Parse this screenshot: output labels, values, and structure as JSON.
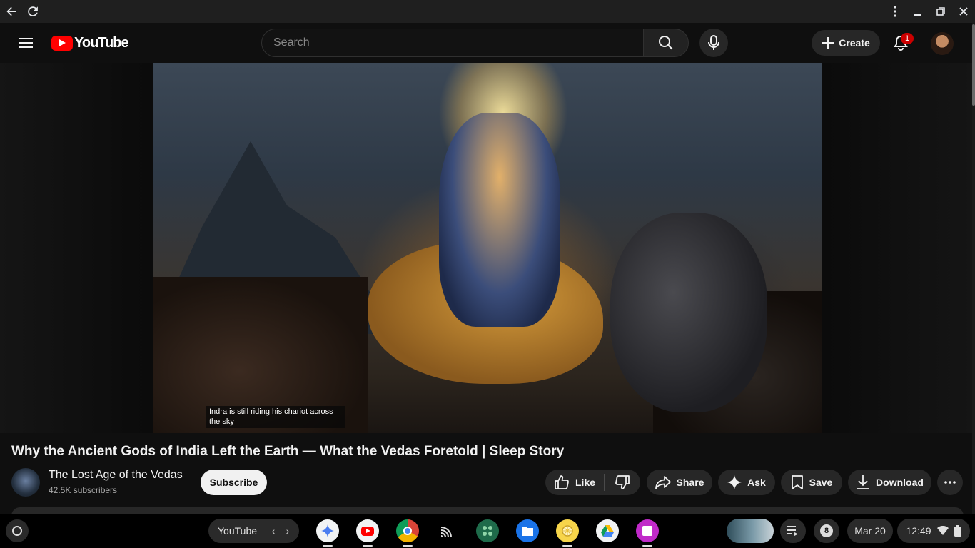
{
  "header": {
    "logo_text": "YouTube",
    "search_placeholder": "Search",
    "create_label": "Create",
    "notification_count": "1"
  },
  "player": {
    "caption": "Indra is still riding his chariot across the sky"
  },
  "video": {
    "title": "Why the Ancient Gods of India Left the Earth — What the Vedas Foretold | Sleep Story",
    "channel_name": "The Lost Age of the Vedas",
    "subscribers": "42.5K subscribers",
    "subscribe_label": "Subscribe",
    "actions": {
      "like": "Like",
      "share": "Share",
      "ask": "Ask",
      "save": "Save",
      "download": "Download"
    }
  },
  "shelf": {
    "desk_label": "YouTube",
    "notification_count": "8",
    "date": "Mar 20",
    "time": "12:49"
  },
  "colors": {
    "brand_red": "#ff0000",
    "background": "#0f0f0f",
    "pill": "#272727"
  }
}
